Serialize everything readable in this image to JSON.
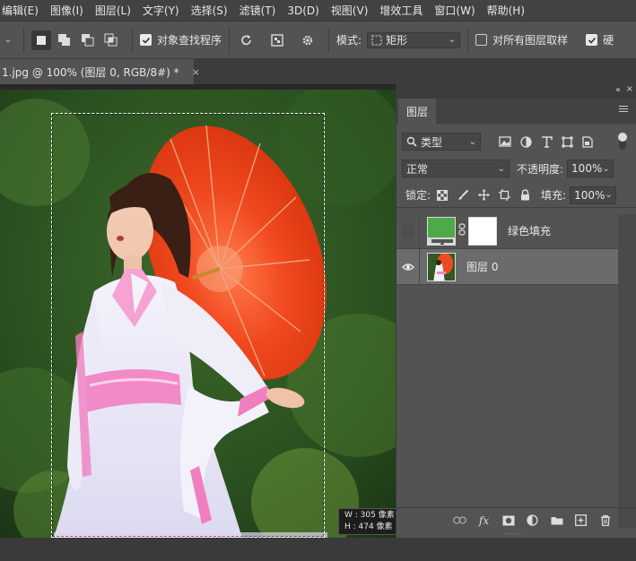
{
  "menu": [
    "编辑(E)",
    "图像(I)",
    "图层(L)",
    "文字(Y)",
    "选择(S)",
    "滤镜(T)",
    "3D(D)",
    "视图(V)",
    "增效工具",
    "窗口(W)",
    "帮助(H)"
  ],
  "options": {
    "object_finder_label": "对象查找程序",
    "object_finder_checked": true,
    "mode_label": "模式:",
    "mode_value": "矩形",
    "sample_all_label": "对所有图层取样",
    "sample_all_checked": false,
    "hard_edge_label": "硬"
  },
  "document_tab": {
    "title": "1.jpg @ 100% (图层 0, RGB/8#) *",
    "close": "×"
  },
  "selection_info": {
    "width_text": "W : 305 像素",
    "height_text": "H : 474 像素"
  },
  "layers_panel": {
    "tab_label": "图层",
    "filter_kind": "类型",
    "blend_mode": "正常",
    "opacity_label": "不透明度:",
    "opacity_value": "100%",
    "lock_label": "锁定:",
    "fill_label": "填充:",
    "fill_value": "100%",
    "layers": [
      {
        "name": "绿色填充",
        "visible": false,
        "selected": false,
        "thumb_color": "#4caa48"
      },
      {
        "name": "图层 0",
        "visible": true,
        "selected": true
      }
    ],
    "bottom_icons": [
      "link-icon",
      "fx-icon",
      "mask-icon",
      "adjustment-icon",
      "folder-icon",
      "new-layer-icon",
      "trash-icon"
    ],
    "fx_label": "fx"
  },
  "colors": {
    "panel_bg": "#535353",
    "menubar_bg": "#424242",
    "selected_layer_bg": "#6b6b6b",
    "umbrella": "#e8401f",
    "foliage": "#2f5a22"
  }
}
